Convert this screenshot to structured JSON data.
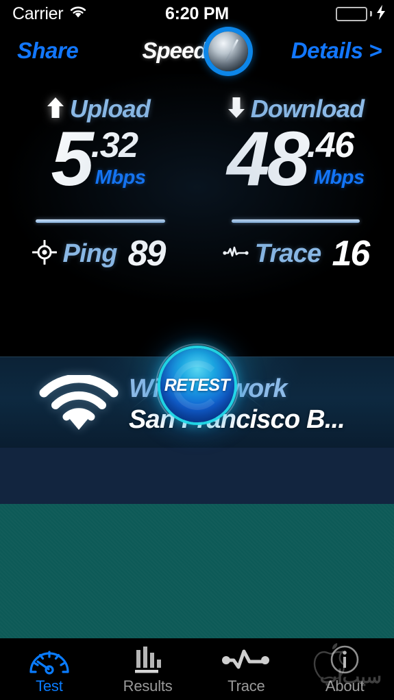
{
  "status_bar": {
    "carrier": "Carrier",
    "wifi_icon": "wifi-icon",
    "time": "6:20 PM",
    "battery_icon": "battery-full-icon",
    "charging_icon": "lightning-bolt-icon",
    "battery_color": "#4cd964"
  },
  "nav_bar": {
    "share_label": "Share",
    "details_label": "Details >",
    "logo_text": "Speed",
    "logo_icon": "speedtest-dial-logo"
  },
  "results": {
    "upload": {
      "label": "Upload",
      "icon": "arrow-up-icon",
      "whole": "5",
      "decimal": ".32",
      "unit": "Mbps"
    },
    "download": {
      "label": "Download",
      "icon": "arrow-down-icon",
      "whole": "48",
      "decimal": ".46",
      "unit": "Mbps"
    },
    "ping": {
      "label": "Ping",
      "icon": "crosshair-icon",
      "value": "89"
    },
    "trace": {
      "label": "Trace",
      "icon": "waveform-icon",
      "value": "16"
    },
    "retest_label": "RETEST",
    "accent_color": "#1277ff",
    "label_color": "#8dbbe8"
  },
  "wifi_panel": {
    "icon": "wifi-large-icon",
    "title": "WiFi Network",
    "network_name": "San Francisco B..."
  },
  "tab_bar": {
    "tabs": [
      {
        "label": "Test",
        "icon": "speedometer-icon",
        "active": true
      },
      {
        "label": "Results",
        "icon": "bar-chart-icon",
        "active": false
      },
      {
        "label": "Trace",
        "icon": "waveform-icon",
        "active": false
      },
      {
        "label": "About",
        "icon": "info-circle-icon",
        "active": false
      }
    ],
    "active_color": "#0a7cff",
    "inactive_color": "#9a9a9a"
  },
  "watermark": {
    "icon": "apple-logo-icon",
    "text": "سیب‌اپ"
  }
}
